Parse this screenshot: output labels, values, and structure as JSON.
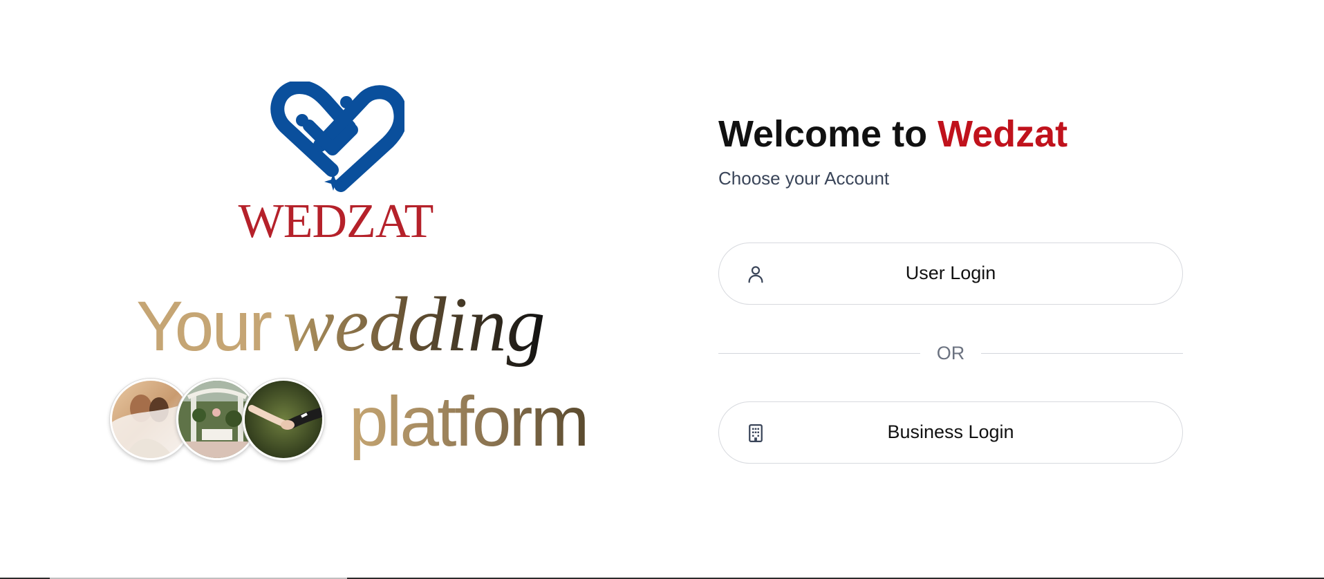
{
  "brand": {
    "logo_icon": "heart-ring-logo-icon",
    "wordmark": "WEDZAT",
    "primary_blue": "#0a4f9c",
    "primary_red": "#b5212a"
  },
  "hero": {
    "tagline_your": "Your",
    "tagline_wedding": "wedding",
    "tagline_platform": "platform",
    "photos": [
      {
        "name": "couple-kiss-veil-photo"
      },
      {
        "name": "garden-ceremony-photo"
      },
      {
        "name": "holding-hands-photo"
      }
    ]
  },
  "login": {
    "welcome_prefix": "Welcome to",
    "welcome_brand": "Wedzat",
    "subtitle": "Choose your Account",
    "user_button": {
      "label": "User Login",
      "icon": "user-icon"
    },
    "divider_text": "OR",
    "business_button": {
      "label": "Business Login",
      "icon": "building-icon"
    }
  }
}
